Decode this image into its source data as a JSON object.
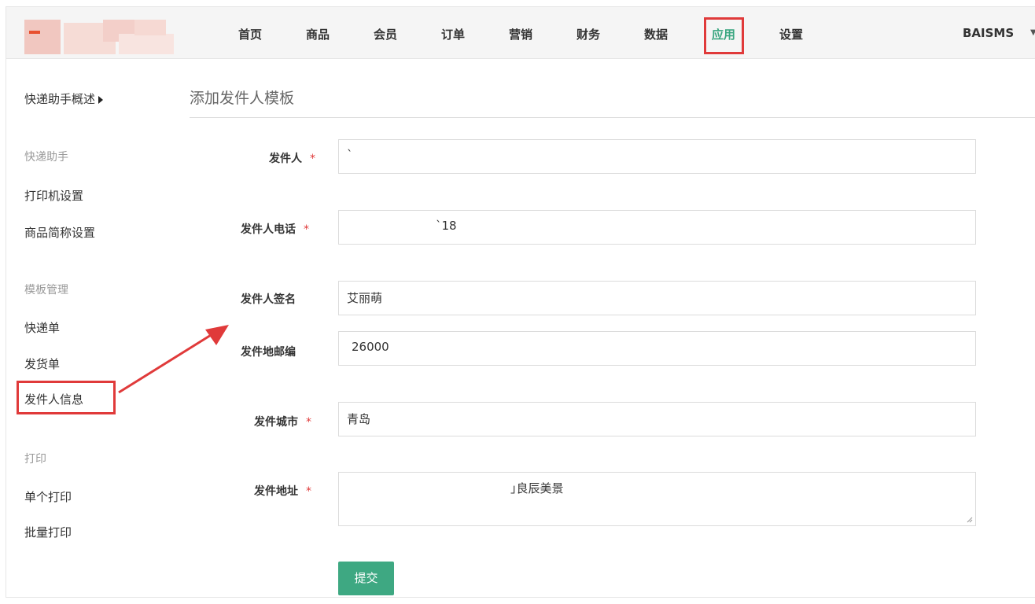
{
  "nav": {
    "items": [
      "首页",
      "商品",
      "会员",
      "订单",
      "营销",
      "财务",
      "数据",
      "应用",
      "设置"
    ],
    "active": "应用",
    "user": "BAISMS",
    "accent": "#3aa680"
  },
  "sidebar": {
    "title": "快递助手概述",
    "groups": [
      {
        "label": "快递助手",
        "links": [
          "打印机设置",
          "商品简称设置"
        ]
      },
      {
        "label": "模板管理",
        "links": [
          "快递单",
          "发货单",
          "发件人信息"
        ]
      },
      {
        "label": "打印",
        "links": [
          "单个打印",
          "批量打印"
        ]
      }
    ],
    "highlighted": "发件人信息"
  },
  "main": {
    "title": "添加发件人模板",
    "fields": [
      {
        "label": "发件人",
        "required": true,
        "value": "`"
      },
      {
        "label": "发件人电话",
        "required": true,
        "value": "`18"
      },
      {
        "label": "发件人签名",
        "required": false,
        "value": "艾丽萌"
      },
      {
        "label": "发件地邮编",
        "required": false,
        "value": "26000"
      },
      {
        "label": "发件城市",
        "required": true,
        "value": "青岛"
      },
      {
        "label": "发件地址",
        "required": true,
        "value": "｣良辰美景"
      }
    ],
    "required_mark": "*",
    "submit_label": "提交"
  },
  "colors": {
    "highlight_box": "#e03a3a",
    "button": "#3ea882"
  }
}
